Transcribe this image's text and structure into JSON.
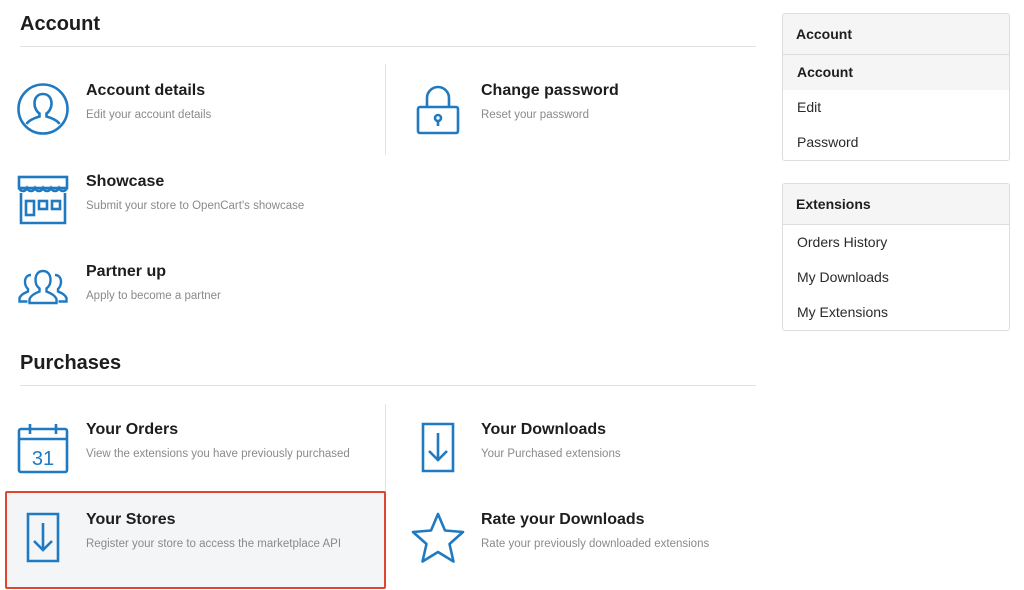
{
  "account_section": {
    "title": "Account",
    "cards": [
      {
        "title": "Account details",
        "desc": "Edit your account details",
        "icon": "user-icon"
      },
      {
        "title": "Change password",
        "desc": "Reset your password",
        "icon": "lock-icon"
      },
      {
        "title": "Showcase",
        "desc": "Submit your store to OpenCart's showcase",
        "icon": "storefront-icon"
      },
      {
        "title": "Partner up",
        "desc": "Apply to become a partner",
        "icon": "users-icon"
      }
    ]
  },
  "purchases_section": {
    "title": "Purchases",
    "cards": [
      {
        "title": "Your Orders",
        "desc": "View the extensions you have previously purchased",
        "icon": "calendar-icon",
        "calendar_day": "31"
      },
      {
        "title": "Your Downloads",
        "desc": "Your Purchased extensions",
        "icon": "download-icon"
      },
      {
        "title": "Your Stores",
        "desc": "Register your store to access the marketplace API",
        "icon": "download-icon",
        "highlighted": true
      },
      {
        "title": "Rate your Downloads",
        "desc": "Rate your previously downloaded extensions",
        "icon": "star-icon"
      }
    ]
  },
  "sidebar": {
    "account_panel": {
      "title": "Account",
      "items": [
        {
          "label": "Account",
          "active": true
        },
        {
          "label": "Edit"
        },
        {
          "label": "Password"
        }
      ]
    },
    "extensions_panel": {
      "title": "Extensions",
      "items": [
        {
          "label": "Orders History"
        },
        {
          "label": "My Downloads"
        },
        {
          "label": "My Extensions"
        }
      ]
    }
  },
  "colors": {
    "icon_blue": "#1f7ac2",
    "highlight_border": "#e0452f",
    "highlight_bg": "#f3f5f7"
  }
}
